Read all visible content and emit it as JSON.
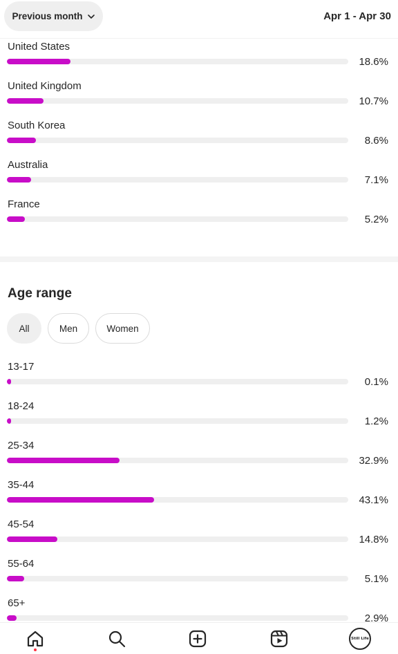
{
  "header": {
    "period_label": "Previous month",
    "date_range": "Apr 1 - Apr 30"
  },
  "countries": [
    {
      "label": "United States",
      "value": "18.6%",
      "fraction": 0.186
    },
    {
      "label": "United Kingdom",
      "value": "10.7%",
      "fraction": 0.107
    },
    {
      "label": "South Korea",
      "value": "8.6%",
      "fraction": 0.086
    },
    {
      "label": "Australia",
      "value": "7.1%",
      "fraction": 0.071
    },
    {
      "label": "France",
      "value": "5.2%",
      "fraction": 0.052
    }
  ],
  "age_section": {
    "title": "Age range",
    "filters": [
      {
        "label": "All",
        "active": true
      },
      {
        "label": "Men",
        "active": false
      },
      {
        "label": "Women",
        "active": false
      }
    ],
    "ranges": [
      {
        "label": "13-17",
        "value": "0.1%",
        "fraction": 0.001
      },
      {
        "label": "18-24",
        "value": "1.2%",
        "fraction": 0.012
      },
      {
        "label": "25-34",
        "value": "32.9%",
        "fraction": 0.329
      },
      {
        "label": "35-44",
        "value": "43.1%",
        "fraction": 0.431
      },
      {
        "label": "45-54",
        "value": "14.8%",
        "fraction": 0.148
      },
      {
        "label": "55-64",
        "value": "5.1%",
        "fraction": 0.051
      },
      {
        "label": "65+",
        "value": "2.9%",
        "fraction": 0.029
      }
    ]
  },
  "colors": {
    "bar_fill": "#c80dc8",
    "bar_track": "#efefef",
    "notification_dot": "#ff3040"
  },
  "bottom_nav": {
    "items": [
      "home-icon",
      "search-icon",
      "create-icon",
      "reels-icon",
      "profile-avatar"
    ],
    "profile_text": "Still Life"
  }
}
